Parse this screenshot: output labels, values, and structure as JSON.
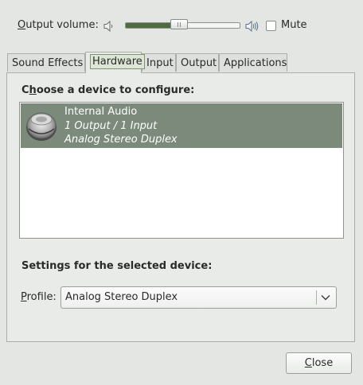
{
  "volume": {
    "label_prefix": "",
    "label_mnemonic": "O",
    "label_rest": "utput volume:",
    "level_fraction": 0.41,
    "low_icon": "speaker-low-icon",
    "high_icon": "speaker-high-icon",
    "mute_label": "Mute",
    "mute_checked": false
  },
  "tabs": [
    {
      "label": "Sound Effects",
      "active": false
    },
    {
      "label": "Hardware",
      "active": true
    },
    {
      "label": "Input",
      "active": false
    },
    {
      "label": "Output",
      "active": false
    },
    {
      "label": "Applications",
      "active": false
    }
  ],
  "hardware": {
    "choose_prefix": "C",
    "choose_mnemonic": "h",
    "choose_rest": "oose a device to configure:",
    "devices": [
      {
        "name": "Internal Audio",
        "io": "1 Output / 1 Input",
        "profile": "Analog Stereo Duplex",
        "icon": "speaker-device-icon",
        "selected": true
      }
    ],
    "settings_heading": "Settings for the selected device:",
    "profile_mnemonic": "P",
    "profile_rest": "rofile:",
    "profile_value": "Analog Stereo Duplex"
  },
  "footer": {
    "close_mnemonic": "C",
    "close_rest": "lose"
  },
  "colors": {
    "selection": "#7b8a7b",
    "volume_fill": "#4f6b3f",
    "window_bg": "#e3e6e3"
  }
}
